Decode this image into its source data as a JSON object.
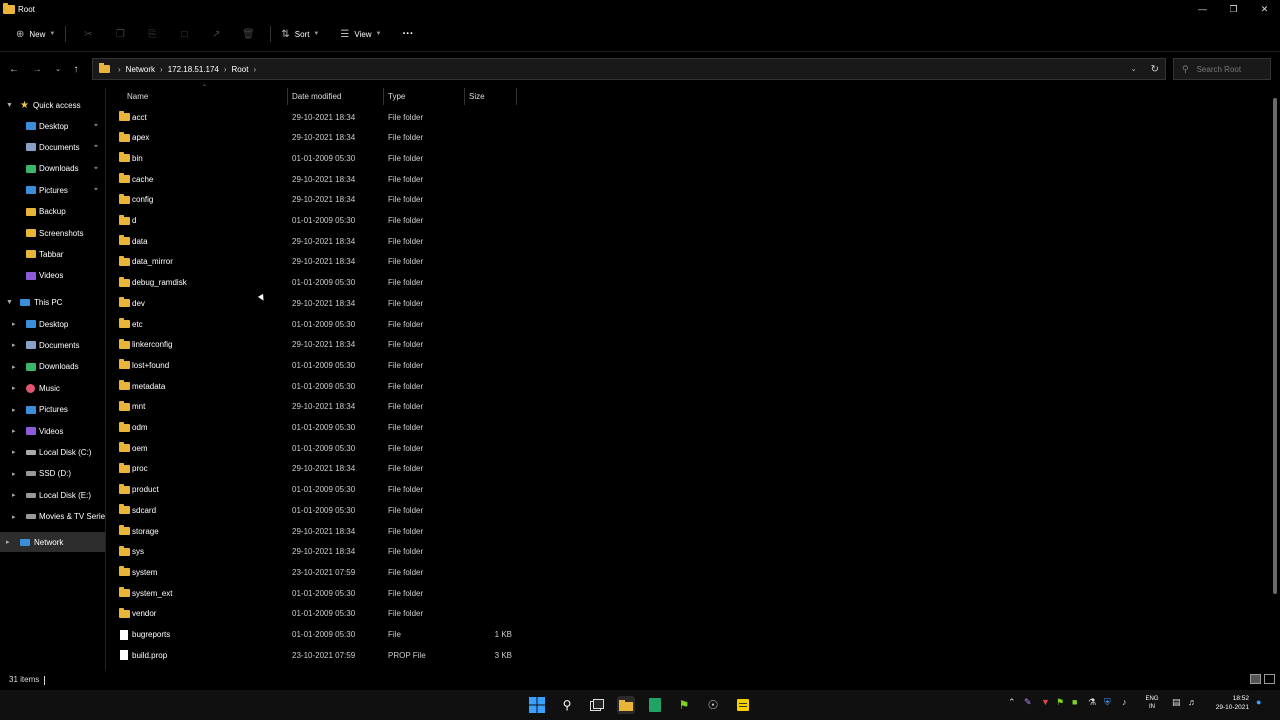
{
  "window": {
    "title": "Root"
  },
  "toolbar": {
    "new_label": "New",
    "sort_label": "Sort",
    "view_label": "View",
    "more_label": "···"
  },
  "address": {
    "crumbs": [
      "Network",
      "172.18.51.174",
      "Root"
    ],
    "search_placeholder": "Search Root"
  },
  "nav": {
    "quick_access": "Quick access",
    "quick_items": [
      "Desktop",
      "Documents",
      "Downloads",
      "Pictures",
      "Backup",
      "Screenshots",
      "Tabbar",
      "Videos"
    ],
    "this_pc": "This PC",
    "pc_items": [
      "Desktop",
      "Documents",
      "Downloads",
      "Music",
      "Pictures",
      "Videos",
      "Local Disk (C:)",
      "SSD (D:)",
      "Local Disk (E:)",
      "Movies & TV Series"
    ],
    "network": "Network"
  },
  "columns": {
    "name": "Name",
    "date": "Date modified",
    "type": "Type",
    "size": "Size"
  },
  "files": [
    {
      "name": "acct",
      "date": "29-10-2021 18:34",
      "type": "File folder",
      "size": ""
    },
    {
      "name": "apex",
      "date": "29-10-2021 18:34",
      "type": "File folder",
      "size": ""
    },
    {
      "name": "bin",
      "date": "01-01-2009 05:30",
      "type": "File folder",
      "size": ""
    },
    {
      "name": "cache",
      "date": "29-10-2021 18:34",
      "type": "File folder",
      "size": ""
    },
    {
      "name": "config",
      "date": "29-10-2021 18:34",
      "type": "File folder",
      "size": ""
    },
    {
      "name": "d",
      "date": "01-01-2009 05:30",
      "type": "File folder",
      "size": ""
    },
    {
      "name": "data",
      "date": "29-10-2021 18:34",
      "type": "File folder",
      "size": ""
    },
    {
      "name": "data_mirror",
      "date": "29-10-2021 18:34",
      "type": "File folder",
      "size": ""
    },
    {
      "name": "debug_ramdisk",
      "date": "01-01-2009 05:30",
      "type": "File folder",
      "size": ""
    },
    {
      "name": "dev",
      "date": "29-10-2021 18:34",
      "type": "File folder",
      "size": ""
    },
    {
      "name": "etc",
      "date": "01-01-2009 05:30",
      "type": "File folder",
      "size": ""
    },
    {
      "name": "linkerconfig",
      "date": "29-10-2021 18:34",
      "type": "File folder",
      "size": ""
    },
    {
      "name": "lost+found",
      "date": "01-01-2009 05:30",
      "type": "File folder",
      "size": ""
    },
    {
      "name": "metadata",
      "date": "01-01-2009 05:30",
      "type": "File folder",
      "size": ""
    },
    {
      "name": "mnt",
      "date": "29-10-2021 18:34",
      "type": "File folder",
      "size": ""
    },
    {
      "name": "odm",
      "date": "01-01-2009 05:30",
      "type": "File folder",
      "size": ""
    },
    {
      "name": "oem",
      "date": "01-01-2009 05:30",
      "type": "File folder",
      "size": ""
    },
    {
      "name": "proc",
      "date": "29-10-2021 18:34",
      "type": "File folder",
      "size": ""
    },
    {
      "name": "product",
      "date": "01-01-2009 05:30",
      "type": "File folder",
      "size": ""
    },
    {
      "name": "sdcard",
      "date": "01-01-2009 05:30",
      "type": "File folder",
      "size": ""
    },
    {
      "name": "storage",
      "date": "29-10-2021 18:34",
      "type": "File folder",
      "size": ""
    },
    {
      "name": "sys",
      "date": "29-10-2021 18:34",
      "type": "File folder",
      "size": ""
    },
    {
      "name": "system",
      "date": "23-10-2021 07:59",
      "type": "File folder",
      "size": ""
    },
    {
      "name": "system_ext",
      "date": "01-01-2009 05:30",
      "type": "File folder",
      "size": ""
    },
    {
      "name": "vendor",
      "date": "01-01-2009 05:30",
      "type": "File folder",
      "size": ""
    },
    {
      "name": "bugreports",
      "date": "01-01-2009 05:30",
      "type": "File",
      "size": "1 KB"
    },
    {
      "name": "build.prop",
      "date": "23-10-2021 07:59",
      "type": "PROP File",
      "size": "3 KB"
    }
  ],
  "status": {
    "items": "31 items"
  },
  "taskbar": {
    "lang_top": "ENG",
    "lang_bottom": "IN",
    "time": "18:52",
    "date": "29-10-2021"
  },
  "colors": {
    "folder": "#e8b53a",
    "background": "#000000",
    "accent": "#0078d4"
  }
}
